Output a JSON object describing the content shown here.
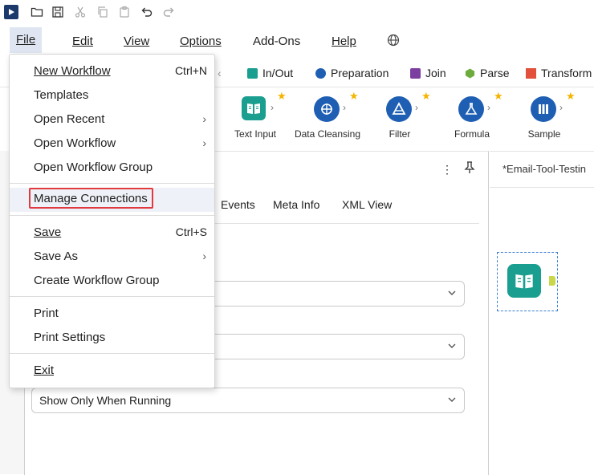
{
  "menubar": {
    "file": "File",
    "edit": "Edit",
    "view": "View",
    "options": "Options",
    "addons": "Add-Ons",
    "help": "Help"
  },
  "categories": [
    {
      "label": "In/Out",
      "color": "#1a9e8f"
    },
    {
      "label": "Preparation",
      "color": "#1f5fb3"
    },
    {
      "label": "Join",
      "color": "#7b3fa0"
    },
    {
      "label": "Parse",
      "color": "#6cab3c"
    },
    {
      "label": "Transform",
      "color": "#e2503c"
    }
  ],
  "tools": [
    {
      "label": "Text Input",
      "color": "#1a9e8f",
      "icon": "book-icon"
    },
    {
      "label": "Data Cleansing",
      "color": "#1f5fb3",
      "icon": "cleansing-icon"
    },
    {
      "label": "Filter",
      "color": "#1f5fb3",
      "icon": "filter-icon"
    },
    {
      "label": "Formula",
      "color": "#1f5fb3",
      "icon": "flask-icon"
    },
    {
      "label": "Sample",
      "color": "#1f5fb3",
      "icon": "sample-icon"
    }
  ],
  "panel": {
    "tabs": [
      "Events",
      "Meta Info",
      "XML View"
    ],
    "dropdown3_value": "Show Only When Running"
  },
  "canvas": {
    "tab_title": "*Email-Tool-Testin"
  },
  "file_menu": {
    "new_workflow": "New Workflow",
    "new_workflow_shortcut": "Ctrl+N",
    "templates": "Templates",
    "open_recent": "Open Recent",
    "open_workflow": "Open Workflow",
    "open_workflow_group": "Open Workflow Group",
    "manage_connections": "Manage Connections",
    "save": "Save",
    "save_shortcut": "Ctrl+S",
    "save_as": "Save As",
    "create_workflow_group": "Create Workflow Group",
    "print": "Print",
    "print_settings": "Print Settings",
    "exit": "Exit"
  },
  "colors": {
    "highlight_border": "#e0393e",
    "menu_active_bg": "#dfe6f2",
    "star": "#f5b400"
  }
}
